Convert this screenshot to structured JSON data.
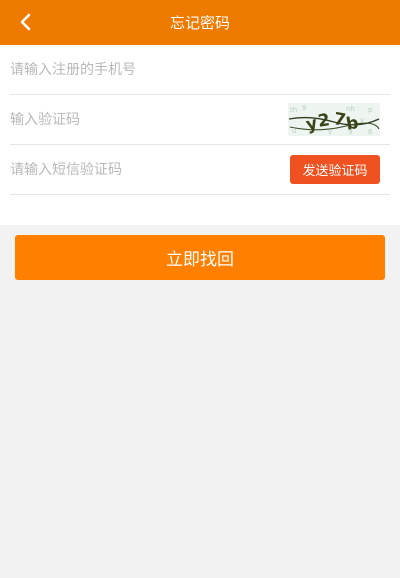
{
  "header": {
    "title": "忘记密码",
    "back_icon": "chevron-left-icon"
  },
  "form": {
    "phone_placeholder": "请输入注册的手机号",
    "captcha_placeholder": "输入验证码",
    "sms_placeholder": "请输入短信验证码",
    "sms_button_label": "发送验证码"
  },
  "submit_label": "立即找回",
  "colors": {
    "header_bg": "#ee7a00",
    "sms_button": "#ef5220",
    "submit_button": "#ff7f00"
  }
}
